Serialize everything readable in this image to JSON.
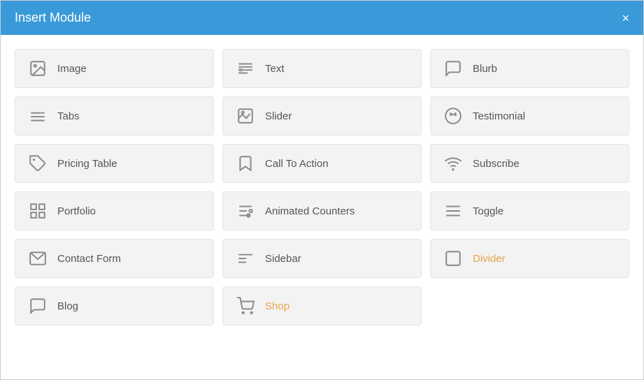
{
  "header": {
    "title": "Insert Module",
    "close_label": "×"
  },
  "modules": [
    {
      "id": "image",
      "label": "Image",
      "icon": "image",
      "orange": false
    },
    {
      "id": "text",
      "label": "Text",
      "icon": "text",
      "orange": false
    },
    {
      "id": "blurb",
      "label": "Blurb",
      "icon": "blurb",
      "orange": false
    },
    {
      "id": "tabs",
      "label": "Tabs",
      "icon": "tabs",
      "orange": false
    },
    {
      "id": "slider",
      "label": "Slider",
      "icon": "slider",
      "orange": false
    },
    {
      "id": "testimonial",
      "label": "Testimonial",
      "icon": "testimonial",
      "orange": false
    },
    {
      "id": "pricing-table",
      "label": "Pricing Table",
      "icon": "pricing",
      "orange": false
    },
    {
      "id": "call-to-action",
      "label": "Call To Action",
      "icon": "cta",
      "orange": false
    },
    {
      "id": "subscribe",
      "label": "Subscribe",
      "icon": "subscribe",
      "orange": false
    },
    {
      "id": "portfolio",
      "label": "Portfolio",
      "icon": "portfolio",
      "orange": false
    },
    {
      "id": "animated-counters",
      "label": "Animated Counters",
      "icon": "counters",
      "orange": false
    },
    {
      "id": "toggle",
      "label": "Toggle",
      "icon": "toggle",
      "orange": false
    },
    {
      "id": "contact-form",
      "label": "Contact Form",
      "icon": "contact",
      "orange": false
    },
    {
      "id": "sidebar",
      "label": "Sidebar",
      "icon": "sidebar",
      "orange": false
    },
    {
      "id": "divider",
      "label": "Divider",
      "icon": "divider",
      "orange": true
    },
    {
      "id": "blog",
      "label": "Blog",
      "icon": "blog",
      "orange": false
    },
    {
      "id": "shop",
      "label": "Shop",
      "icon": "shop",
      "orange": true
    }
  ]
}
